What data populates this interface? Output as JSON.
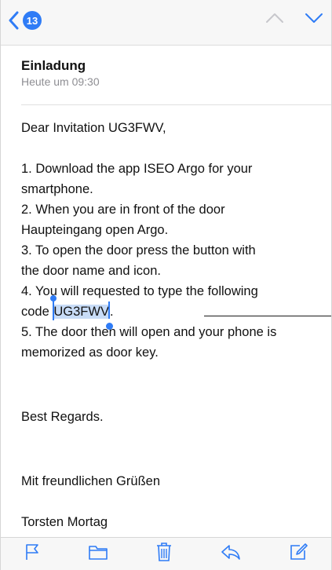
{
  "nav": {
    "unread_count": "13",
    "accent_color": "#2f7cf6"
  },
  "header": {
    "subject": "Einladung",
    "date": "Heute um 09:30"
  },
  "body": {
    "greeting": "Dear Invitation UG3FWV,",
    "line1": "1. Download the app ISEO Argo for your",
    "line2": "smartphone.",
    "line3": "2. When you are in front of the door",
    "line4": "Haupteingang open Argo.",
    "line5": "3. To open the door press the button with",
    "line6": "the door name and icon.",
    "line7": "4. You will requested to type the following",
    "line8_prefix": "code ",
    "code": "UG3FWV",
    "line8_suffix": ".",
    "line9": "5. The door then will open and your phone is",
    "line10": "memorized as door key.",
    "regards": "Best Regards.",
    "regards_de": "Mit freundlichen Grüßen",
    "signature": "Torsten Mortag"
  },
  "toolbar": {
    "icons": [
      "flag-icon",
      "folder-icon",
      "trash-icon",
      "reply-icon",
      "compose-icon"
    ]
  }
}
